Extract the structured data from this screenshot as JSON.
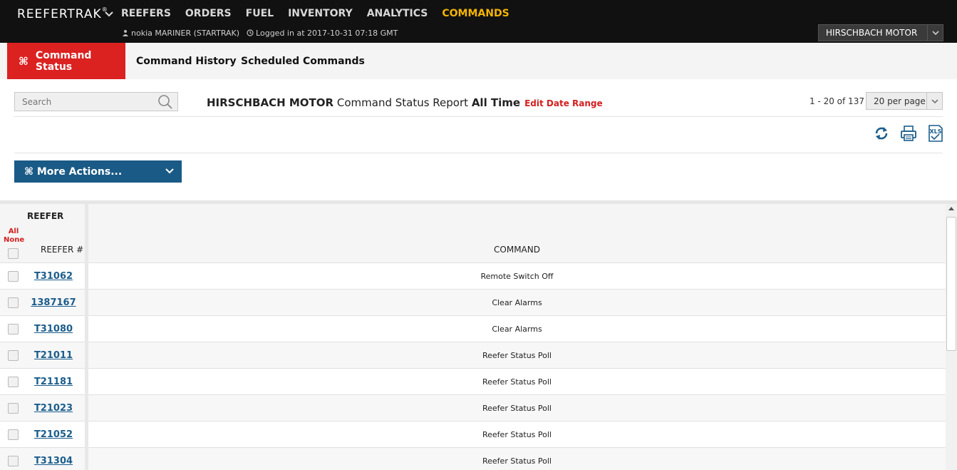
{
  "brand": {
    "name": "REEFERTRAK",
    "mark": "®"
  },
  "nav": [
    {
      "label": "REEFERS"
    },
    {
      "label": "ORDERS"
    },
    {
      "label": "FUEL"
    },
    {
      "label": "INVENTORY"
    },
    {
      "label": "ANALYTICS"
    },
    {
      "label": "COMMANDS",
      "active": true
    }
  ],
  "user": {
    "name": "nokia MARINER (STARTRAK)",
    "login": "Logged in at 2017-10-31 07:18 GMT"
  },
  "company_select": {
    "value": "HIRSCHBACH MOTOR"
  },
  "tabs": [
    {
      "label": "Command Status",
      "active": true
    },
    {
      "label": "Command History"
    },
    {
      "label": "Scheduled Commands"
    }
  ],
  "search": {
    "placeholder": "Search"
  },
  "report": {
    "company": "HIRSCHBACH MOTOR",
    "title": "Command Status Report",
    "range": "All Time",
    "edit_label": "Edit Date Range"
  },
  "pagination": {
    "info": "1 - 20 of 137",
    "per_page": "20 per page"
  },
  "more_actions": {
    "label": "⌘ More Actions..."
  },
  "table": {
    "group_header": "REEFER",
    "all_label": "All",
    "none_label": "None",
    "col_reefer": "REEFER #",
    "col_command": "COMMAND",
    "rows": [
      {
        "reefer": "T31062",
        "command": "Remote Switch Off"
      },
      {
        "reefer": "1387167",
        "command": "Clear Alarms"
      },
      {
        "reefer": "T31080",
        "command": "Clear Alarms"
      },
      {
        "reefer": "T21011",
        "command": "Reefer Status Poll"
      },
      {
        "reefer": "T21181",
        "command": "Reefer Status Poll"
      },
      {
        "reefer": "T21023",
        "command": "Reefer Status Poll"
      },
      {
        "reefer": "T21052",
        "command": "Reefer Status Poll"
      },
      {
        "reefer": "T31304",
        "command": "Reefer Status Poll"
      }
    ]
  },
  "colors": {
    "topbar": "#111111",
    "active_nav": "#f5b400",
    "active_tab": "#dc2121",
    "link": "#1b5d8c",
    "action_button": "#1a5a86",
    "edit_link": "#d42020"
  },
  "icons": [
    "chevron-down-icon",
    "user-icon",
    "clock-icon",
    "command-icon",
    "search-icon",
    "refresh-icon",
    "print-icon",
    "xls-export-icon"
  ]
}
